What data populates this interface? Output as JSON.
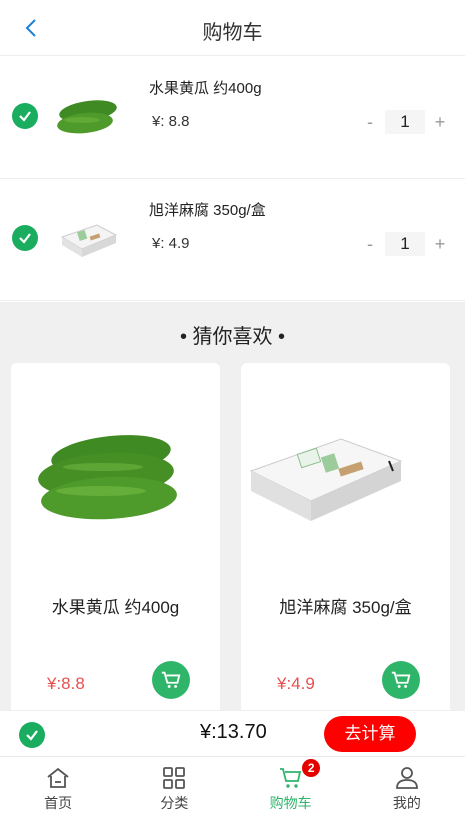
{
  "header": {
    "title": "购物车"
  },
  "cart": {
    "items": [
      {
        "name": "水果黄瓜 约400g",
        "price": "¥: 8.8",
        "qty": "1",
        "minus": "-",
        "plus": "+"
      },
      {
        "name": "旭洋麻腐 350g/盒",
        "price": "¥: 4.9",
        "qty": "1",
        "minus": "-",
        "plus": "+"
      }
    ]
  },
  "recommend": {
    "title": "• 猜你喜欢 •",
    "products": [
      {
        "name": "水果黄瓜 约400g",
        "price": "¥:8.8"
      },
      {
        "name": "旭洋麻腐 350g/盒",
        "price": "¥:4.9"
      }
    ]
  },
  "checkout": {
    "total": "¥:13.70",
    "button": "去计算"
  },
  "tabbar": {
    "tabs": [
      {
        "label": "首页",
        "icon": "home-icon"
      },
      {
        "label": "分类",
        "icon": "category-grid-icon"
      },
      {
        "label": "购物车",
        "icon": "cart-icon",
        "badge": "2"
      },
      {
        "label": "我的",
        "icon": "user-icon"
      }
    ],
    "active_color": "#2fb56a"
  },
  "colors": {
    "accent": "#1aad5f",
    "price": "#e85050",
    "checkout": "#ff0000",
    "badge": "#e50000"
  }
}
